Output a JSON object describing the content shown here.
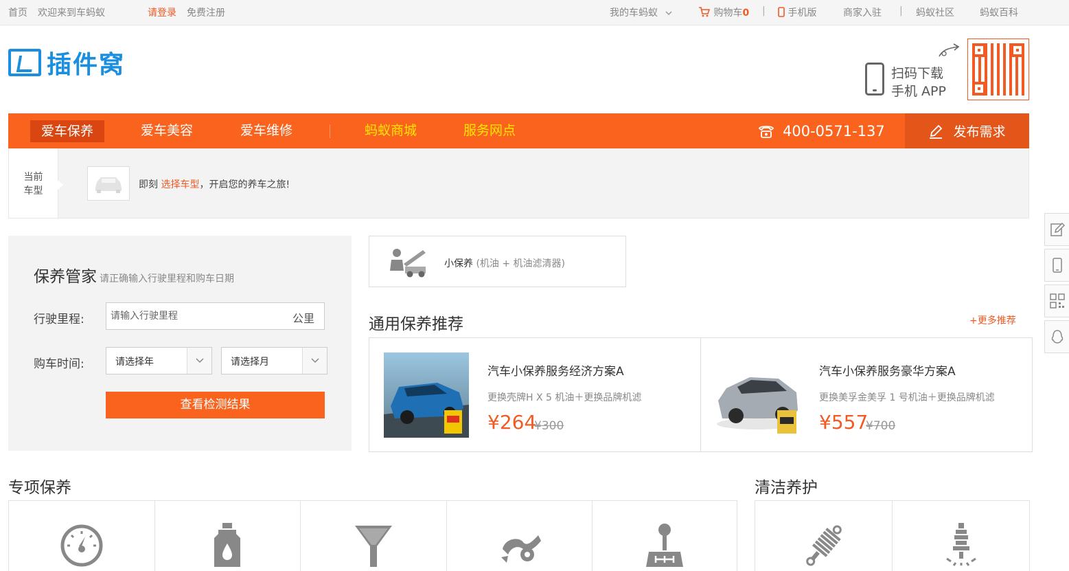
{
  "topbar": {
    "home": "首页",
    "welcome": "欢迎来到车蚂蚁",
    "login": "请登录",
    "register": "免费注册",
    "my_account": "我的车蚂蚁",
    "cart_label": "购物车",
    "cart_count": "0",
    "mobile": "手机版",
    "merchant": "商家入驻",
    "community": "蚂蚁社区",
    "wiki": "蚂蚁百科"
  },
  "header": {
    "logo_text": "插件窝",
    "app_line1": "扫码下载",
    "app_line2": "手机 APP"
  },
  "nav": {
    "items": [
      {
        "label": "爱车保养"
      },
      {
        "label": "爱车美容"
      },
      {
        "label": "爱车维修"
      },
      {
        "label": "蚂蚁商城"
      },
      {
        "label": "服务网点"
      }
    ],
    "phone": "400-0571-137",
    "publish": "发布需求"
  },
  "car_strip": {
    "label_line1": "当前",
    "label_line2": "车型",
    "hint_prefix": "即刻",
    "hint_link": "选择车型",
    "hint_suffix": "，开启您的养车之旅!"
  },
  "manager": {
    "title": "保养管家",
    "subtitle": "请正确输入行驶里程和购车日期",
    "mileage_label": "行驶里程:",
    "mileage_placeholder": "请输入行驶里程",
    "mileage_unit": "公里",
    "date_label": "购车时间:",
    "year_select": "请选择年",
    "month_select": "请选择月",
    "submit": "查看检测结果"
  },
  "small_care": {
    "name": "小保养",
    "detail": "(机油 + 机油滤清器)"
  },
  "recommend": {
    "title": "通用保养推荐",
    "more": "+更多推荐",
    "items": [
      {
        "name": "汽车小保养服务经济方案A",
        "desc": "更换壳牌H X 5 机油＋更换品牌机滤",
        "price": "¥264",
        "old_price": "¥300"
      },
      {
        "name": "汽车小保养服务豪华方案A",
        "desc": "更换美孚金美孚 1 号机油＋更换品牌机滤",
        "price": "¥557",
        "old_price": "¥700"
      }
    ]
  },
  "sections": {
    "special": "专项保养",
    "clean": "清洁养护"
  },
  "colors": {
    "brand_orange": "#f9631e",
    "logo_blue": "#1b8ee0",
    "nav_highlight": "#ffe600"
  }
}
